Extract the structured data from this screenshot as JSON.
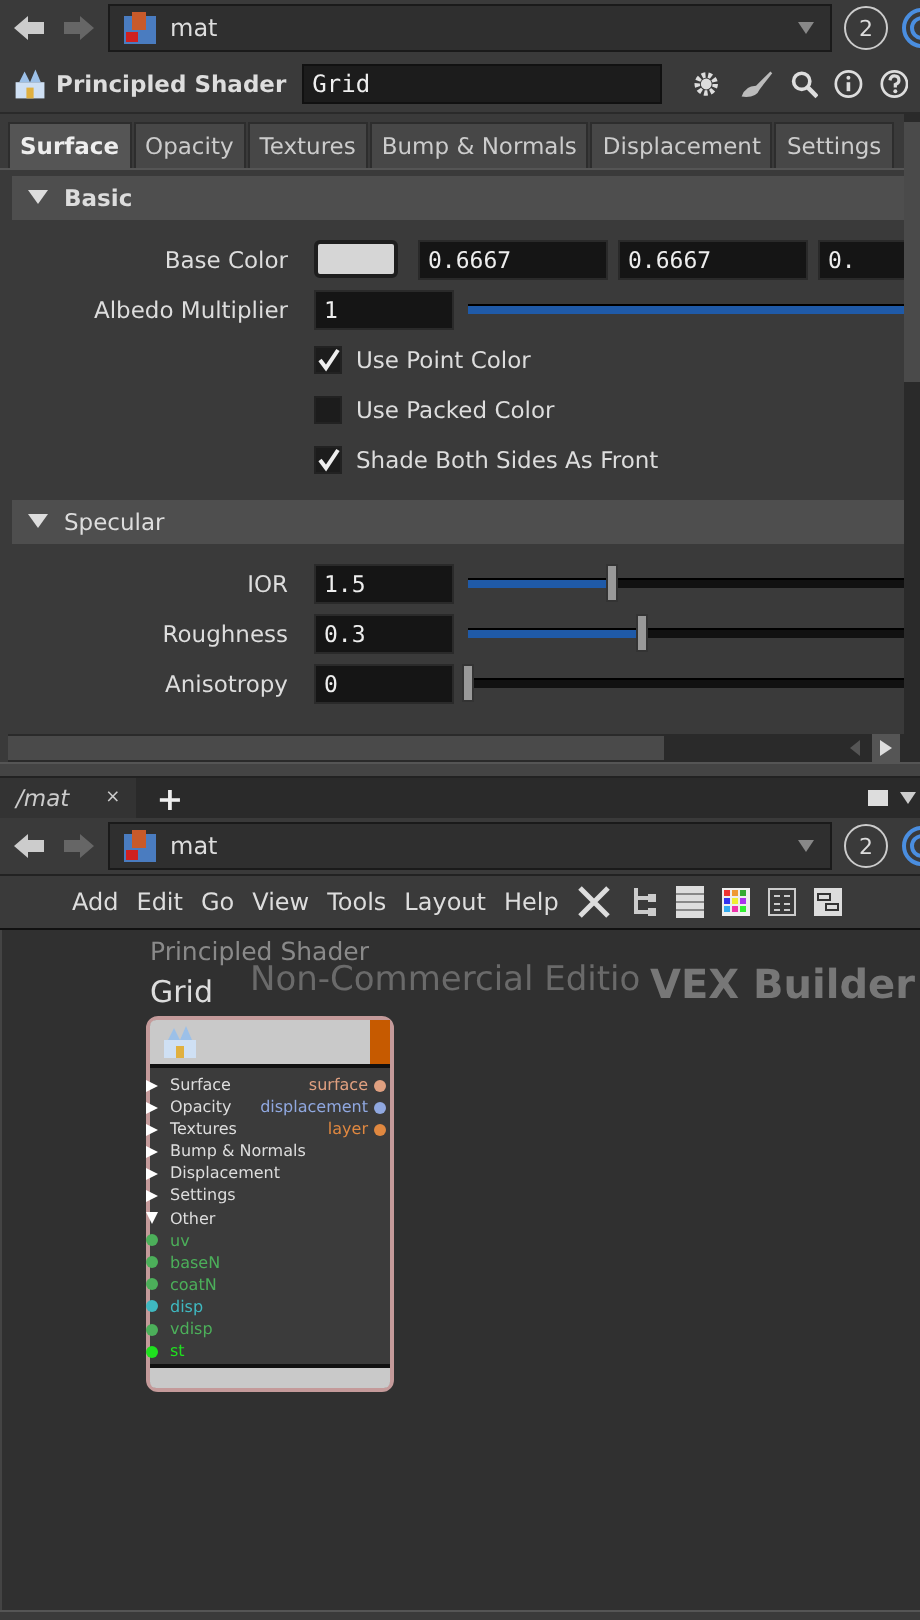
{
  "top_path": {
    "label": "mat",
    "badge": "2"
  },
  "parameter_header": {
    "node_type": "Principled Shader",
    "node_name": "Grid"
  },
  "tabs": [
    {
      "label": "Surface",
      "selected": true
    },
    {
      "label": "Opacity",
      "selected": false
    },
    {
      "label": "Textures",
      "selected": false
    },
    {
      "label": "Bump & Normals",
      "selected": false
    },
    {
      "label": "Displacement",
      "selected": false
    },
    {
      "label": "Settings",
      "selected": false
    }
  ],
  "sections": [
    {
      "title": "Basic",
      "expanded": true,
      "rows": [
        {
          "kind": "color",
          "label": "Base Color",
          "values": [
            "0.6667",
            "0.6667",
            "0."
          ]
        },
        {
          "kind": "slider",
          "label": "Albedo Multiplier",
          "value": "1",
          "level": 1
        },
        {
          "kind": "checkbox",
          "label": "Use Point Color",
          "checked": true
        },
        {
          "kind": "checkbox",
          "label": "Use Packed Color",
          "checked": false
        },
        {
          "kind": "checkbox",
          "label": "Shade Both Sides As Front",
          "checked": true
        }
      ]
    },
    {
      "title": "Specular",
      "expanded": true,
      "rows": [
        {
          "kind": "slider",
          "label": "IOR",
          "value": "1.5",
          "level": 0.33
        },
        {
          "kind": "slider",
          "label": "Roughness",
          "value": "0.3",
          "level": 0.4
        },
        {
          "kind": "slider",
          "label": "Anisotropy",
          "value": "0",
          "level": 0
        }
      ]
    }
  ],
  "pane_tab": {
    "label": "/mat",
    "close": "×",
    "add": "+"
  },
  "network_path": {
    "label": "mat",
    "badge": "2"
  },
  "menu": [
    "Add",
    "Edit",
    "Go",
    "View",
    "Tools",
    "Layout",
    "Help"
  ],
  "network": {
    "edition": "Non-Commercial Editio",
    "context": "VEX Builder",
    "node": {
      "type": "Principled Shader",
      "name": "Grid",
      "inputs": [
        {
          "label": "Surface",
          "expanded": false
        },
        {
          "label": "Opacity",
          "expanded": false
        },
        {
          "label": "Textures",
          "expanded": false
        },
        {
          "label": "Bump & Normals",
          "expanded": false
        },
        {
          "label": "Displacement",
          "expanded": false
        },
        {
          "label": "Settings",
          "expanded": false
        },
        {
          "label": "Other",
          "expanded": true,
          "children": [
            {
              "label": "uv",
              "color": "#4caf5a"
            },
            {
              "label": "baseN",
              "color": "#4caf5a"
            },
            {
              "label": "coatN",
              "color": "#4caf5a"
            },
            {
              "label": "disp",
              "color": "#3fb8c0"
            },
            {
              "label": "vdisp",
              "color": "#4caf5a"
            },
            {
              "label": "st",
              "color": "#1fe01f"
            }
          ]
        }
      ],
      "outputs": [
        {
          "label": "surface",
          "color": "#e0a080"
        },
        {
          "label": "displacement",
          "color": "#90a8e0"
        },
        {
          "label": "layer",
          "color": "#e08840"
        }
      ]
    }
  }
}
